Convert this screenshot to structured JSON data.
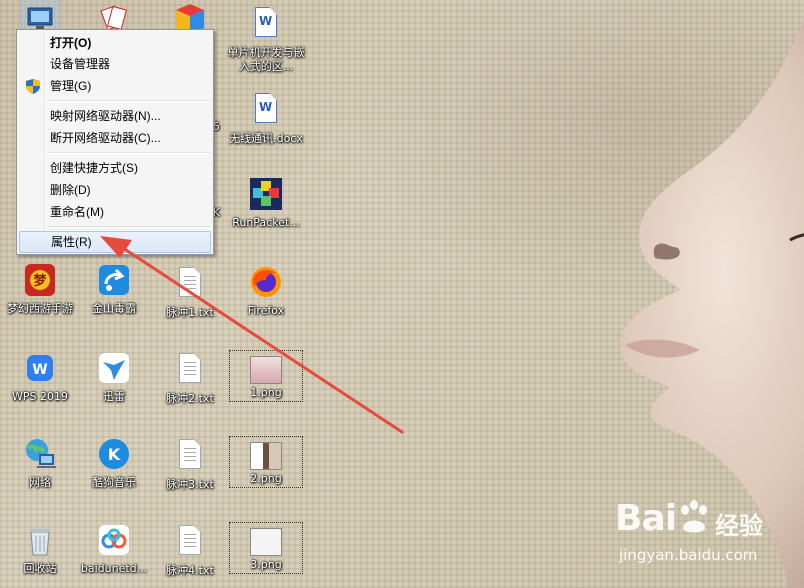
{
  "desktop_icons": {
    "wps_doc1": "单片机开发与嵌入式的区...",
    "wps_doc2": "无线通讯.docx",
    "col3_partial_a": "5",
    "col3_partial_b": "K",
    "runpacket": "RunPacket...",
    "menghuan": "梦幻西游手游",
    "jinshan": "金山毒霸",
    "pulse1": "脉冲1.txt",
    "firefox": "Firefox",
    "wps2019": "WPS 2019",
    "xunlei": "迅雷",
    "pulse2": "脉冲2.txt",
    "png1": "1.png",
    "network": "网络",
    "kugou": "酷狗音乐",
    "pulse3": "脉冲3.txt",
    "png2": "2.png",
    "recycle": "回收站",
    "baidunet": "baidunetd...",
    "pulse4": "脉冲4.txt",
    "png3": "3.png"
  },
  "context_menu": {
    "open": "打开(O)",
    "device_manager": "设备管理器",
    "manage": "管理(G)",
    "map_drive": "映射网络驱动器(N)...",
    "disconnect_drive": "断开网络驱动器(C)...",
    "create_shortcut": "创建快捷方式(S)",
    "delete": "删除(D)",
    "rename": "重命名(M)",
    "properties": "属性(R)"
  },
  "watermark": {
    "brand": "Bai",
    "brand_suffix": "经验",
    "url": "jingyan.baidu.com"
  },
  "colors": {
    "arrow": "#e84a3c",
    "menu_highlight": "#dbe8f7",
    "wallpaper": "#d9d1bc"
  }
}
